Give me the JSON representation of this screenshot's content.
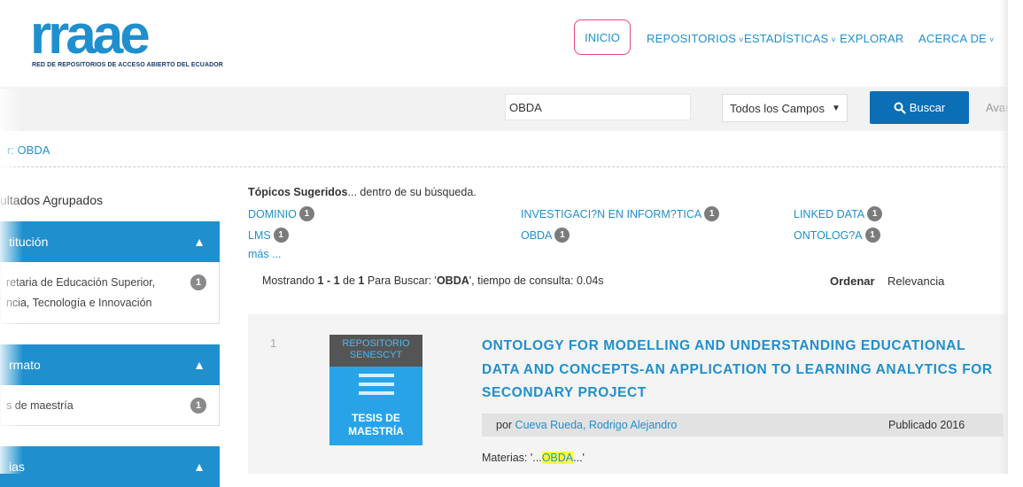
{
  "header": {
    "logo_text": "rraae",
    "logo_subtitle": "RED DE REPOSITORIOS DE ACCESO ABIERTO DEL ECUADOR",
    "nav": {
      "inicio": "INICIO",
      "repositorios": "REPOSITORIOS",
      "estadisticas": "ESTADÍSTICAS",
      "explorar": "EXPLORAR",
      "acerca": "ACERCA DE"
    },
    "chevron": "˅"
  },
  "search": {
    "query": "OBDA",
    "scope": "Todos los Campos",
    "button_label": "Buscar",
    "advanced_label": "Avanzada"
  },
  "breadcrumb": "r: OBDA",
  "sidebar": {
    "title": "ultados Agrupados",
    "facets": [
      {
        "header": "titución",
        "items": [
          {
            "label_line1": "retaria de Educación Superior,",
            "label_line2": "ncia, Tecnología e Innovación",
            "count": "1"
          }
        ]
      },
      {
        "header": "rmato",
        "items": [
          {
            "label_line1": "s de maestría",
            "count": "1"
          }
        ]
      },
      {
        "header": "ias"
      }
    ]
  },
  "topics": {
    "title_bold": "Tópicos Sugeridos",
    "title_rest": "... dentro de su búsqueda.",
    "items": [
      {
        "label": "DOMINIO",
        "count": "1"
      },
      {
        "label": "INVESTIGACI?N EN INFORM?TICA",
        "count": "1"
      },
      {
        "label": "LINKED DATA",
        "count": "1"
      },
      {
        "label": "LMS",
        "count": "1"
      },
      {
        "label": "OBDA",
        "count": "1"
      },
      {
        "label": "ONTOLOG?A",
        "count": "1"
      }
    ],
    "more": "más ..."
  },
  "results": {
    "summary_prefix": "Mostrando ",
    "summary_range": "1 - 1",
    "summary_of": " de ",
    "summary_total": "1",
    "summary_for": " Para Buscar: '",
    "summary_query": "OBDA",
    "summary_time": "', tiempo de consulta: 0.04s",
    "sort_label": "Ordenar",
    "sort_value": "Relevancia",
    "items": [
      {
        "number": "1",
        "thumb_top": "REPOSITORIO SENESCYT",
        "thumb_label": "TESIS DE MAESTRÍA",
        "title": "ONTOLOGY FOR MODELLING AND UNDERSTANDING EDUCATIONAL DATA AND CONCEPTS-AN APPLICATION TO LEARNING ANALYTICS FOR SECONDARY PROJECT",
        "author_prefix": "por ",
        "author": "Cueva Rueda, Rodrigo Alejandro",
        "published": "Publicado 2016",
        "subjects_prefix": "Materias: '...",
        "subjects_highlight": "OBDA",
        "subjects_suffix": "...'"
      }
    ]
  },
  "colors": {
    "accent": "#1f8fce",
    "button": "#0c6fb5",
    "nav_active_border": "#e0467c",
    "highlight": "#ffff3c"
  }
}
